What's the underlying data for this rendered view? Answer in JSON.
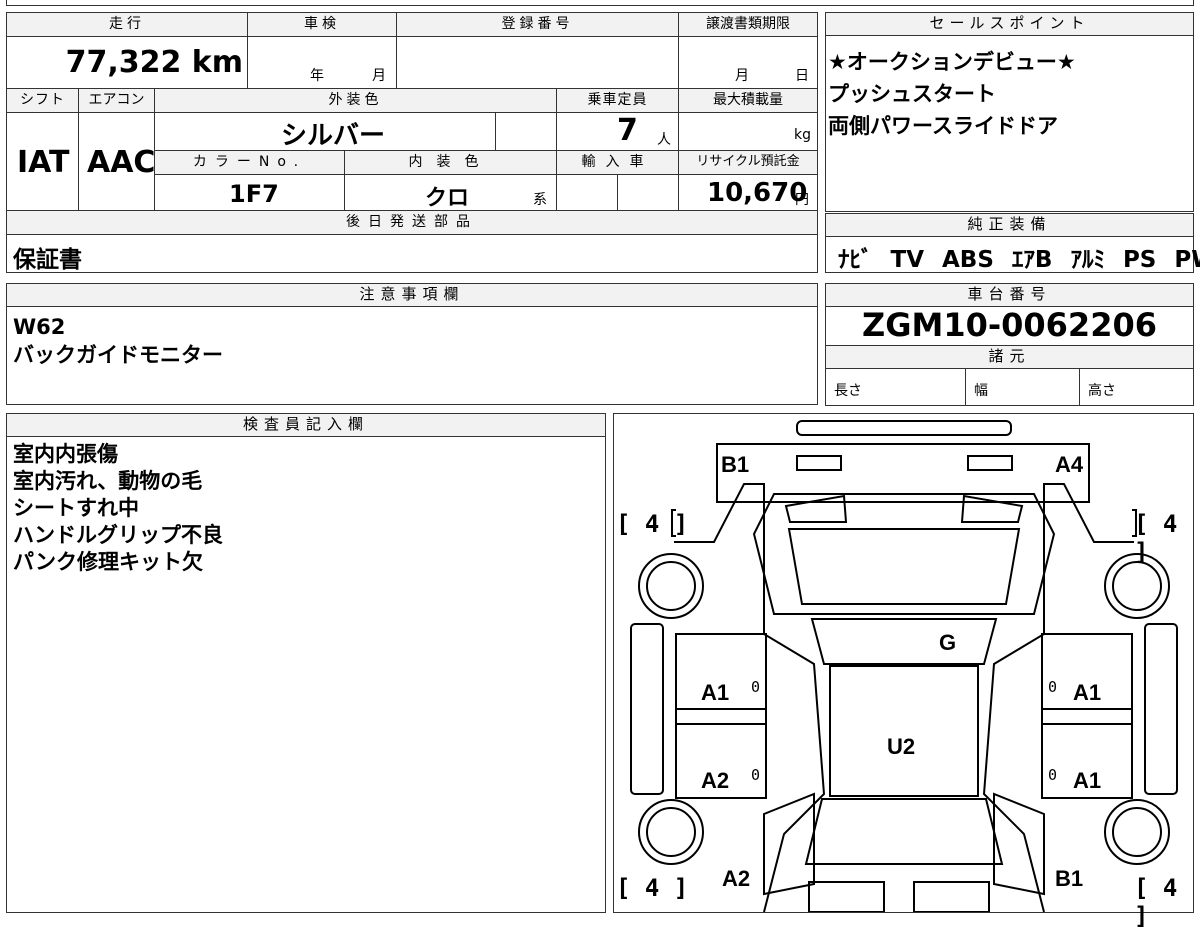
{
  "spec": {
    "headers": {
      "mileage": "走行",
      "inspection": "車検",
      "registration": "登録番号",
      "transfer_deadline": "譲渡書類期限",
      "shift": "シフト",
      "aircon": "エアコン",
      "exterior_color": "外装色",
      "capacity": "乗車定員",
      "max_load": "最大積載量",
      "color_no": "カラーNo.",
      "interior_color": "内装色",
      "import": "輸入車",
      "recycle": "リサイクル預託金"
    },
    "mileage_value": "77,322 km",
    "inspection_year_unit": "年",
    "inspection_month_unit": "月",
    "transfer_month_unit": "月",
    "transfer_day_unit": "日",
    "shift_value": "IAT",
    "aircon_value": "AAC",
    "exterior_color_value": "シルバー",
    "capacity_value": "7",
    "capacity_unit": "人",
    "max_load_unit": "kg",
    "color_no_value": "1F7",
    "interior_color_value": "クロ",
    "interior_suffix": "系",
    "recycle_value": "10,670",
    "recycle_unit": "円"
  },
  "later_parts": {
    "header": "後日発送部品",
    "value": "保証書"
  },
  "sales_points": {
    "header": "セールスポイント",
    "items": [
      "★オークションデビュー★",
      "プッシュスタート",
      "両側パワースライドドア"
    ]
  },
  "genuine_equipment": {
    "header": "純正装備",
    "value": "ﾅﾋﾞ TV ABS ｴｱB ｱﾙﾐ PS PW"
  },
  "notes": {
    "header": "注意事項欄",
    "lines": [
      "W62",
      "バックガイドモニター"
    ]
  },
  "chassis": {
    "header": "車台番号",
    "value": "ZGM10-0062206"
  },
  "specs": {
    "header": "諸元",
    "length": "長さ",
    "width": "幅",
    "height": "高さ"
  },
  "inspector": {
    "header": "検査員記入欄",
    "lines": [
      "室内内張傷",
      "室内汚れ、動物の毛",
      "シートすれ中",
      "ハンドルグリップ不良",
      "パンク修理キット欠"
    ]
  },
  "diagram": {
    "labels": {
      "front_left": "B1",
      "front_right": "A4",
      "g": "G",
      "left_front_door": "A1",
      "right_front_door": "A1",
      "u": "U2",
      "left_rear_door": "A2",
      "right_rear_door": "A1",
      "rear_left": "A2",
      "rear_right": "B1",
      "zero_lf": "0",
      "zero_rf": "0",
      "zero_lr": "0",
      "zero_rr": "0"
    },
    "tires": {
      "front_left": "[ 4 ]",
      "front_right": "[ 4 ]",
      "rear_left": "[ 4 ]",
      "rear_right": "[ 4 ]"
    }
  }
}
